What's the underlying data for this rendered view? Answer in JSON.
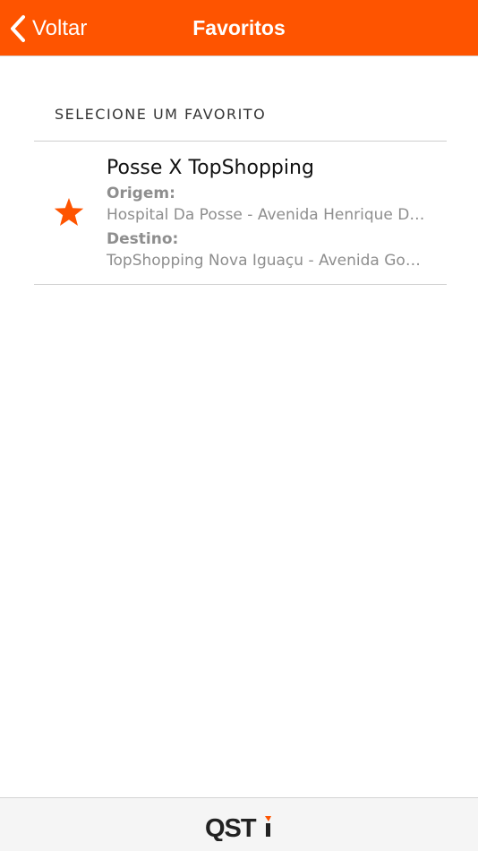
{
  "header": {
    "back_label": "Voltar",
    "title": "Favoritos",
    "background_color": "#fe5400"
  },
  "main": {
    "section_label": "SELECIONE UM FAVORITO",
    "favorites": [
      {
        "icon": "star-icon",
        "title": "Posse X TopShopping",
        "origin_label": "Origem:",
        "origin_value": "Hospital Da Posse - Avenida Henrique Duque Estrada Mayer",
        "destination_label": "Destino:",
        "destination_value": "TopShopping Nova Iguaçu - Avenida Governador Amaral Peixoto"
      }
    ]
  },
  "footer": {
    "logo": "QSTi"
  },
  "colors": {
    "accent": "#fe5400",
    "secondary_text": "#8e8e8e"
  }
}
